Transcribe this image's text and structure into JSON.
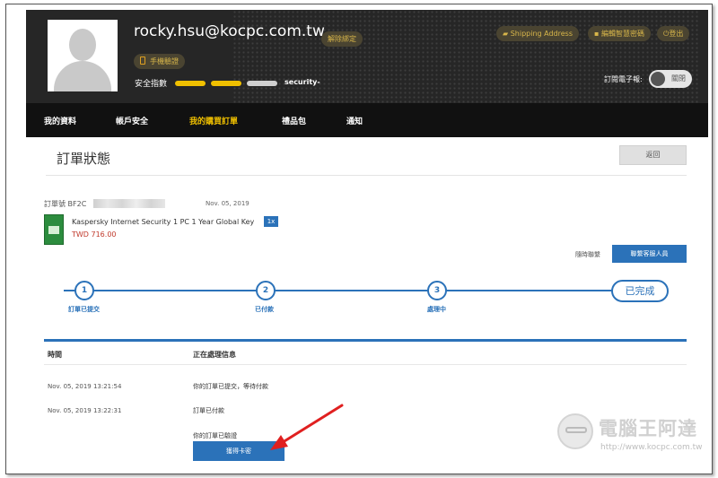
{
  "header": {
    "email": "rocky.hsu@kocpc.com.tw",
    "unbind_label": "解除綁定",
    "phone_verify_label": "手機驗證",
    "shipping_label": "Shipping Address",
    "edit_password_label": "編輯智慧密碼",
    "logout_label": "登出",
    "security_label": "安全指數",
    "security_level": "security-",
    "security_score": 2,
    "security_max": 3,
    "newsletter_label": "訂閱電子報:",
    "newsletter_toggle_label": "關閉"
  },
  "nav": {
    "items": [
      {
        "label": "我的資料"
      },
      {
        "label": "帳戶安全"
      },
      {
        "label": "我的購買訂單",
        "active": true
      },
      {
        "label": "禮品包"
      },
      {
        "label": "通知"
      }
    ]
  },
  "main": {
    "title": "訂單狀態",
    "back_label": "返回",
    "order": {
      "number_label": "訂單號 BF2C",
      "date": "Nov. 05, 2019",
      "product_name": "Kaspersky Internet Security 1 PC 1 Year Global Key",
      "quantity": "1x",
      "price": "TWD 716.00"
    },
    "contact_label": "隨時聯繫",
    "contact_button": "聯繫客服人員",
    "steps": [
      {
        "number": "1",
        "label": "訂單已提交"
      },
      {
        "number": "2",
        "label": "已付款"
      },
      {
        "number": "3",
        "label": "處理中"
      },
      {
        "label": "已完成"
      }
    ],
    "log": {
      "headers": [
        "時間",
        "正在處理信息"
      ],
      "rows": [
        {
          "time": "Nov. 05, 2019 13:21:54",
          "message": "你的訂單已提交，等待付款"
        },
        {
          "time": "Nov. 05, 2019 13:22:31",
          "message": "訂單已付款"
        },
        {
          "time": "",
          "message": "你的訂單已驗證"
        }
      ],
      "reveal_button": "獲得卡密"
    }
  },
  "watermark": {
    "title": "電腦王阿達",
    "url": "http://www.kocpc.com.tw"
  },
  "colors": {
    "accent_blue": "#2b72b9",
    "header_bg": "#262626",
    "nav_bg": "#111111",
    "active_tab": "#f0c000",
    "price_red": "#c0392b",
    "annotation_red": "#e02020"
  }
}
